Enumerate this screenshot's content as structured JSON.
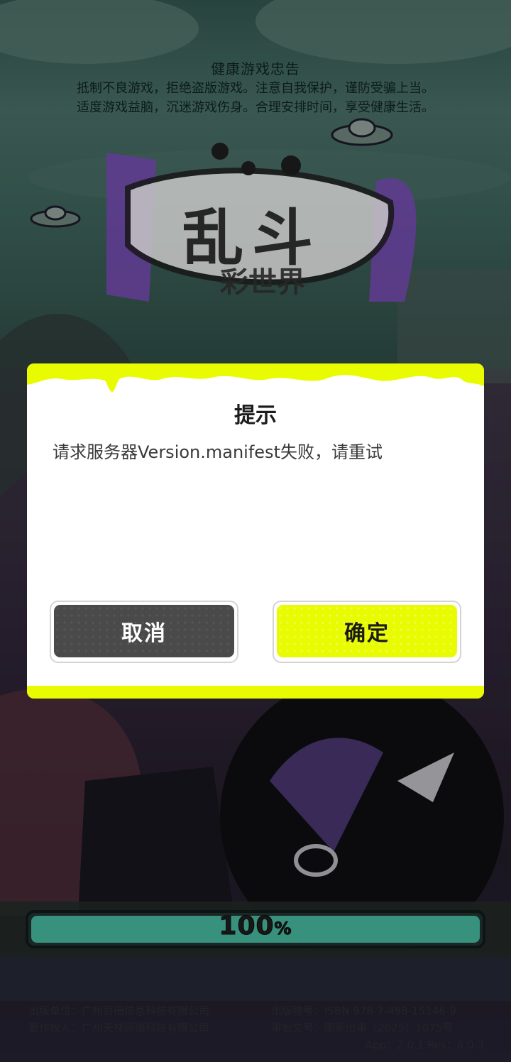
{
  "notice": {
    "title": "健康游戏忠告",
    "line1": "抵制不良游戏，拒绝盗版游戏。注意自我保护，谨防受骗上当。",
    "line2": "适度游戏益脑，沉迷游戏伤身。合理安排时间，享受健康生活。"
  },
  "logo": {
    "main": "乱斗",
    "sub": "彩世界"
  },
  "dialog": {
    "title": "提示",
    "message": "请求服务器Version.manifest失败，请重试",
    "cancel_label": "取消",
    "confirm_label": "确定"
  },
  "progress": {
    "value": 100,
    "number": "100",
    "unit": "%"
  },
  "footer": {
    "publisher": "出版单位：广州百田信息科技有限公司",
    "copyright": "著作权人：广州天梯网络科技有限公司",
    "isbn": "出版物号：ISBN 978-7-498-15146-9",
    "approval": "审批文号：国新出审〔2025〕1075号",
    "version": "App：2.0.1  Res：6.0.3"
  },
  "colors": {
    "accent": "#e8fb00",
    "progress": "#3d9e87",
    "dialog_bg": "#ffffff",
    "cancel_bg": "#4a4a4a"
  }
}
